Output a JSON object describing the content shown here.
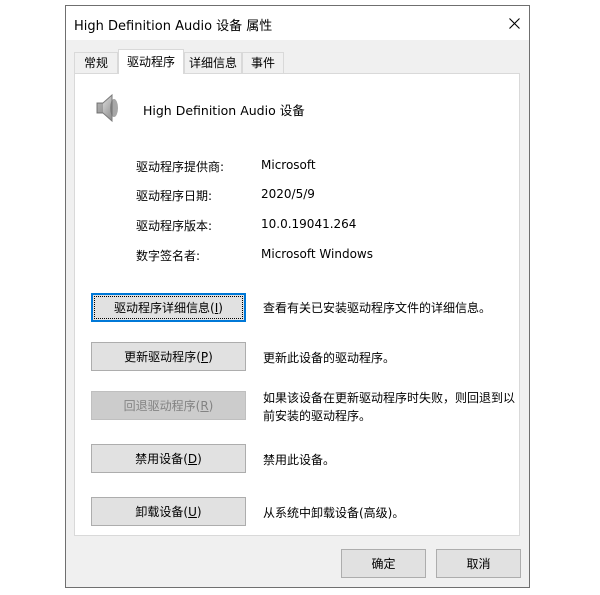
{
  "window": {
    "title": "High Definition Audio 设备 属性"
  },
  "tabs": [
    {
      "label": "常规",
      "active": false
    },
    {
      "label": "驱动程序",
      "active": true
    },
    {
      "label": "详细信息",
      "active": false
    },
    {
      "label": "事件",
      "active": false
    }
  ],
  "device": {
    "name": "High Definition Audio 设备",
    "icon": "speaker-icon"
  },
  "info": [
    {
      "label": "驱动程序提供商:",
      "value": "Microsoft"
    },
    {
      "label": "驱动程序日期:",
      "value": "2020/5/9"
    },
    {
      "label": "驱动程序版本:",
      "value": "10.0.19041.264"
    },
    {
      "label": "数字签名者:",
      "value": "Microsoft Windows"
    }
  ],
  "actions": [
    {
      "label": "驱动程序详细信息",
      "hotkey": "I",
      "description": "查看有关已安装驱动程序文件的详细信息。",
      "enabled": true
    },
    {
      "label": "更新驱动程序",
      "hotkey": "P",
      "description": "更新此设备的驱动程序。",
      "enabled": true
    },
    {
      "label": "回退驱动程序",
      "hotkey": "R",
      "description": "如果该设备在更新驱动程序时失败，则回退到以前安装的驱动程序。",
      "enabled": false
    },
    {
      "label": "禁用设备",
      "hotkey": "D",
      "description": "禁用此设备。",
      "enabled": true
    },
    {
      "label": "卸载设备",
      "hotkey": "U",
      "description": "从系统中卸载设备(高级)。",
      "enabled": true
    }
  ],
  "footer": {
    "ok": "确定",
    "cancel": "取消"
  }
}
